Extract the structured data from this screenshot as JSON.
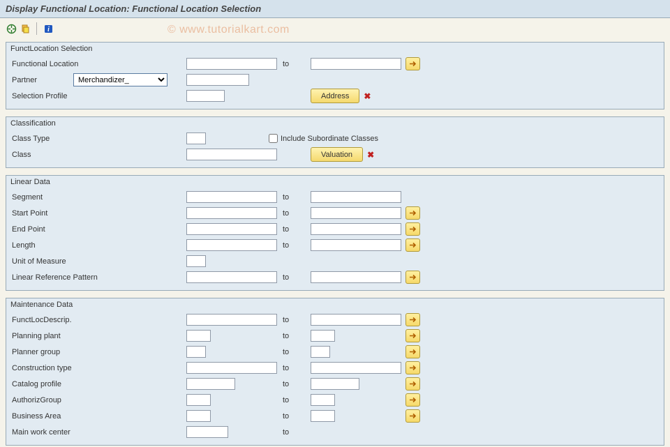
{
  "page_title": "Display Functional Location: Functional Location Selection",
  "watermark": "© www.tutorialkart.com",
  "groups": {
    "sel": {
      "title": "FunctLocation Selection",
      "func_loc": "Functional Location",
      "partner": "Partner",
      "partner_sel": "Merchandizer_",
      "sel_profile": "Selection Profile",
      "to": "to",
      "address_btn": "Address"
    },
    "cls": {
      "title": "Classification",
      "class_type": "Class Type",
      "class": "Class",
      "include_sub": "Include Subordinate Classes",
      "valuation_btn": "Valuation"
    },
    "lin": {
      "title": "Linear Data",
      "segment": "Segment",
      "start": "Start Point",
      "end": "End Point",
      "length": "Length",
      "uom": "Unit of Measure",
      "lrp": "Linear Reference Pattern",
      "to": "to"
    },
    "mnt": {
      "title": "Maintenance Data",
      "desc": "FunctLocDescrip.",
      "pplant": "Planning plant",
      "pgroup": "Planner group",
      "ctype": "Construction type",
      "catprof": "Catalog profile",
      "authgrp": "AuthorizGroup",
      "barea": "Business Area",
      "mwc": "Main work center",
      "to": "to"
    }
  }
}
